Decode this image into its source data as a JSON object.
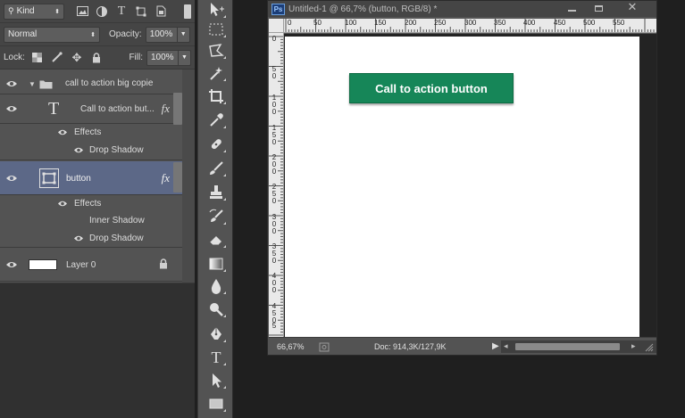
{
  "colors": {
    "cta_bg": "#168658",
    "canvas_bg": "#ffffff",
    "panel_bg": "#535353",
    "selected_row": "#5c6887",
    "ps_badge": "#1c3e78"
  },
  "layers_panel": {
    "filter_kind": "Kind",
    "blend_mode": "Normal",
    "opacity_label": "Opacity:",
    "opacity_value": "100%",
    "lock_label": "Lock:",
    "fill_label": "Fill:",
    "fill_value": "100%",
    "layers": {
      "group": {
        "name": "call to action big copie"
      },
      "text_layer": {
        "name": "Call to action but...",
        "fx": "fx",
        "effects_label": "Effects",
        "effect1": "Drop Shadow"
      },
      "button_layer": {
        "name": "button",
        "fx": "fx",
        "effects_label": "Effects",
        "effect1": "Inner Shadow",
        "effect2": "Drop Shadow"
      },
      "background_layer": {
        "name": "Layer 0"
      }
    }
  },
  "toolbar": {
    "tools": [
      "move-tool",
      "marquee-tool",
      "lasso-tool",
      "magic-wand-tool",
      "crop-tool",
      "eyedropper-tool",
      "healing-brush-tool",
      "brush-tool",
      "clone-stamp-tool",
      "history-brush-tool",
      "eraser-tool",
      "gradient-tool",
      "blur-tool",
      "dodge-tool",
      "pen-tool",
      "type-tool",
      "path-selection-tool",
      "rectangle-tool"
    ]
  },
  "document": {
    "badge": "Ps",
    "title": "Untitled-1 @ 66,7% (button, RGB/8) *",
    "ruler_h": [
      "0",
      "50",
      "100",
      "150",
      "200",
      "250",
      "300",
      "350",
      "400",
      "450",
      "500",
      "550"
    ],
    "ruler_v": [
      [
        "0"
      ],
      [
        "5",
        "0"
      ],
      [
        "1",
        "0",
        "0"
      ],
      [
        "1",
        "5",
        "0"
      ],
      [
        "2",
        "0",
        "0"
      ],
      [
        "2",
        "5",
        "0"
      ],
      [
        "3",
        "0",
        "0"
      ],
      [
        "3",
        "5",
        "0"
      ],
      [
        "4",
        "0",
        "0"
      ],
      [
        "4",
        "5",
        "0"
      ],
      [
        "5",
        "0"
      ]
    ],
    "cta_label": "Call to action button",
    "status": {
      "zoom": "66,67%",
      "doc_info": "Doc: 914,3K/127,9K"
    }
  }
}
